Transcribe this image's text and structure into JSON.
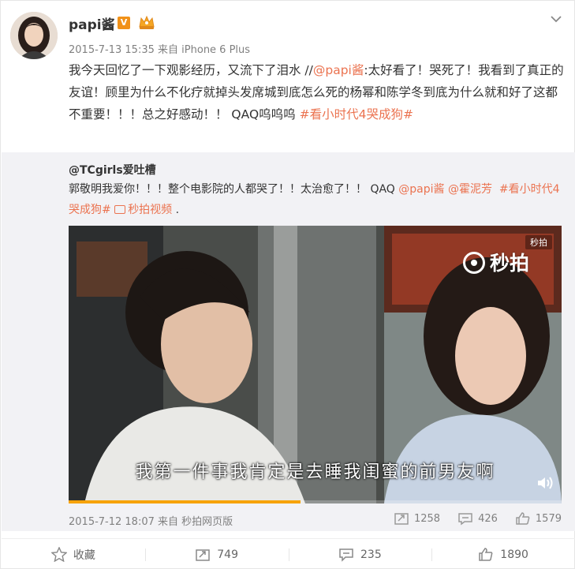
{
  "user": {
    "name": "papi酱",
    "verified_badge": "V",
    "avatar_label": ""
  },
  "post": {
    "date": "2015-7-13 15:35",
    "source_prefix": "来自",
    "source": "iPhone 6 Plus",
    "text_part1": "我今天回忆了一下观影经历，又流下了泪水 //",
    "mention": "@papi酱",
    "text_part2": ":太好看了！哭死了！我看到了真正的友谊！顾里为什么不化疗就掉头发席城到底怎么死的杨幂和陈学冬到底为什么就和好了这都不重要！！！总之好感动！！ QAQ呜呜呜 ",
    "hashtag": "#看小时代4哭成狗#"
  },
  "repost": {
    "author": "@TCgirls爱吐槽",
    "text_part1": "郭敬明我爱你！！！整个电影院的人都哭了！！太治愈了！！ QAQ ",
    "mention1": "@papi酱",
    "mention2": "@霍泥芳",
    "hashtag": "#看小时代4哭成狗#",
    "video_link": "秒拍视频",
    "trailing": ".",
    "video": {
      "subtitle": "我第一件事我肯定是去睡我闺蜜的前男友啊",
      "watermark_small": "秒拍",
      "watermark_big": "秒拍",
      "progress": 0.47
    },
    "date": "2015-7-12 18:07",
    "source_prefix": "来自",
    "source": "秒拍网页版",
    "stats": {
      "reposts": "1258",
      "comments": "426",
      "likes": "1579"
    }
  },
  "actions": {
    "favorite": "收藏",
    "repost": "749",
    "comment": "235",
    "like": "1890"
  },
  "colors": {
    "accent": "#eb7350",
    "badge": "#f19118",
    "progress": "#f7a30a",
    "repost_bg": "#f2f2f5"
  },
  "icons": [
    "vip-crown-icon",
    "chevron-down-icon",
    "repost-icon",
    "comment-icon",
    "like-icon",
    "star-icon",
    "volume-icon",
    "miaopai-logo-icon",
    "video-clip-icon"
  ]
}
